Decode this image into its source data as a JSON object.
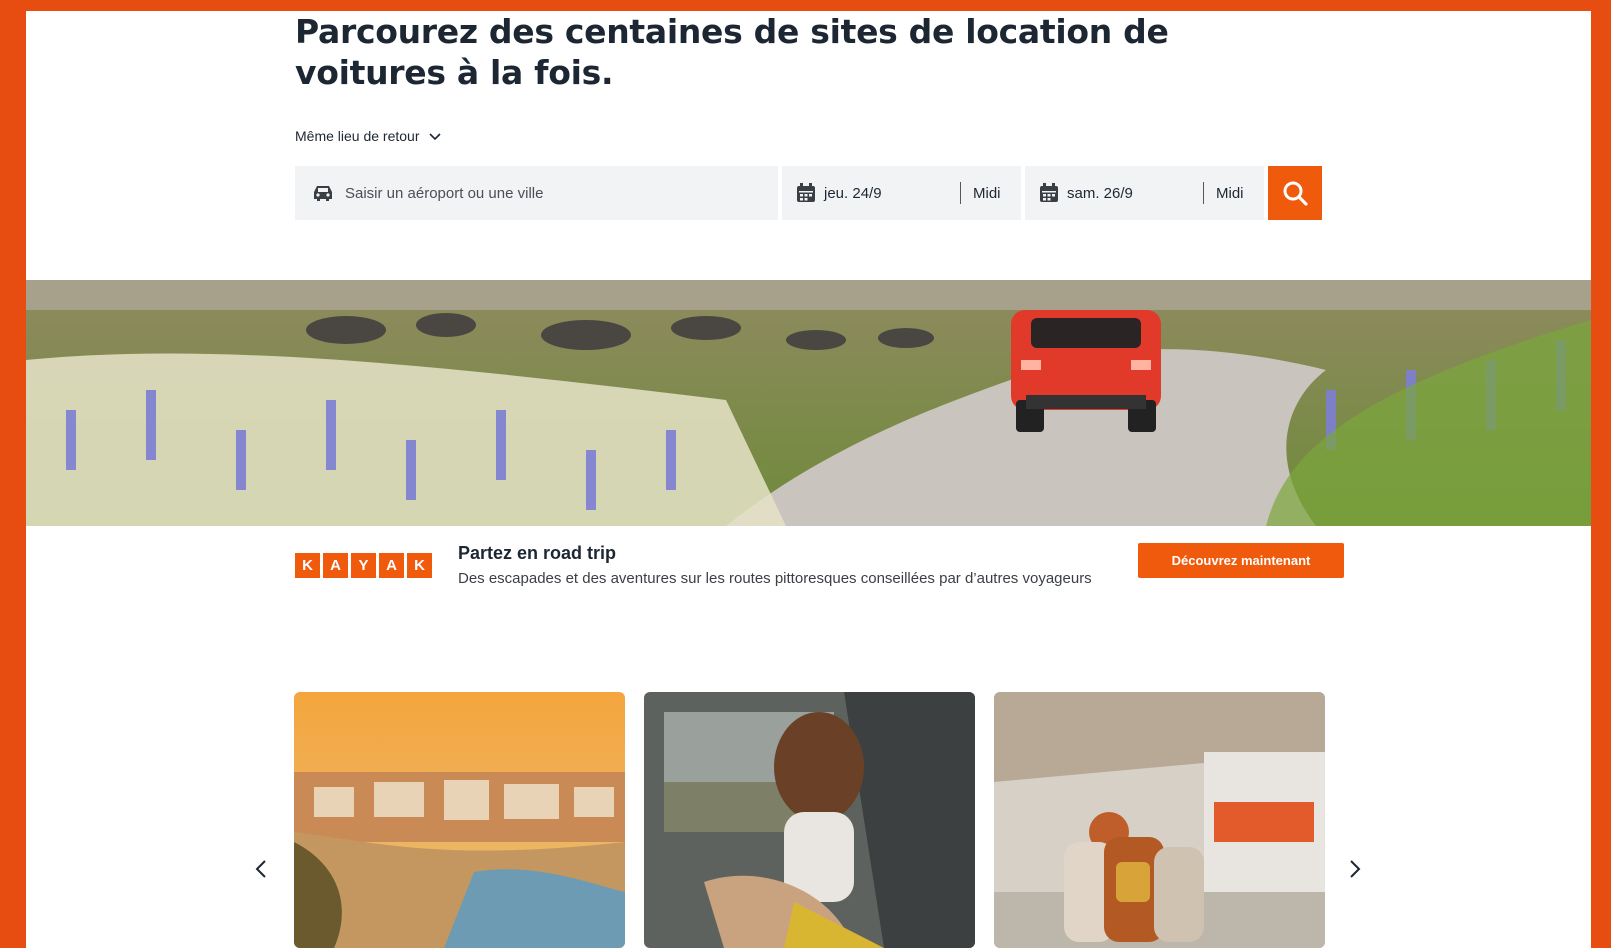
{
  "hero": {
    "title": "Parcourez des centaines de sites de location de voitures à la fois."
  },
  "search": {
    "dropoff_label": "Même lieu de retour",
    "location_placeholder": "Saisir un aéroport ou une ville",
    "pickup_date": "jeu. 24/9",
    "pickup_time": "Midi",
    "return_date": "sam. 26/9",
    "return_time": "Midi"
  },
  "promo": {
    "logo_letters": [
      "K",
      "A",
      "Y",
      "A",
      "K"
    ],
    "title": "Partez en road trip",
    "description": "Des escapades et des aventures sur les routes pittoresques conseillées par d’autres voyageurs",
    "button_label": "Découvrez maintenant"
  },
  "colors": {
    "brand": "#f05a0c",
    "frame": "#e74c10",
    "field_bg": "#f2f3f5",
    "text_dark": "#1d2733"
  },
  "icons": {
    "location": "car-icon",
    "date": "calendar-icon",
    "search": "search-icon",
    "dropdown": "chevron-down-icon",
    "prev": "chevron-left-icon",
    "next": "chevron-right-icon"
  }
}
